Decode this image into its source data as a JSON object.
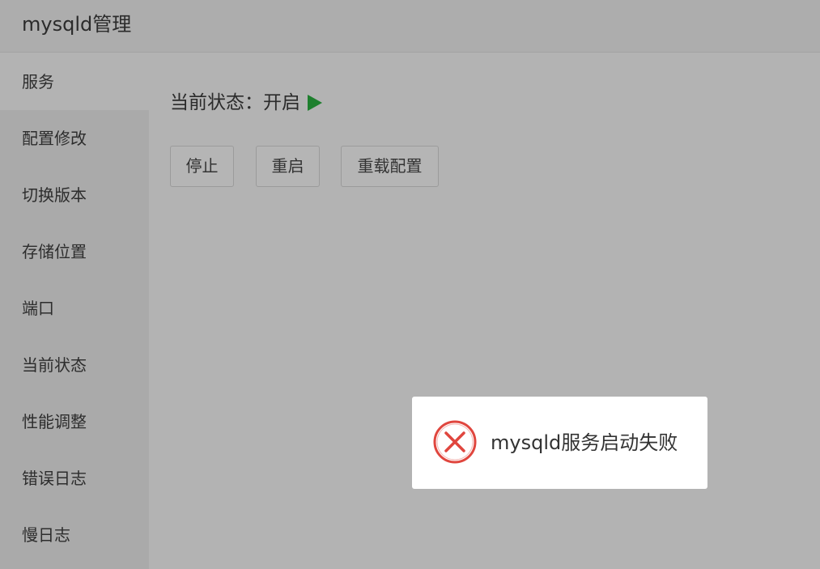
{
  "header": {
    "title": "mysqld管理"
  },
  "sidebar": {
    "items": [
      {
        "label": "服务",
        "active": true
      },
      {
        "label": "配置修改"
      },
      {
        "label": "切换版本"
      },
      {
        "label": "存储位置"
      },
      {
        "label": "端口"
      },
      {
        "label": "当前状态"
      },
      {
        "label": "性能调整"
      },
      {
        "label": "错误日志"
      },
      {
        "label": "慢日志"
      }
    ]
  },
  "main": {
    "status_label": "当前状态：",
    "status_value": "开启",
    "status_icon": "play-icon",
    "status_color": "#1e7f2e",
    "buttons": {
      "stop": "停止",
      "restart": "重启",
      "reload": "重载配置"
    }
  },
  "toast": {
    "icon": "error-circle-x-icon",
    "icon_color": "#e0463e",
    "message": "mysqld服务启动失败"
  }
}
